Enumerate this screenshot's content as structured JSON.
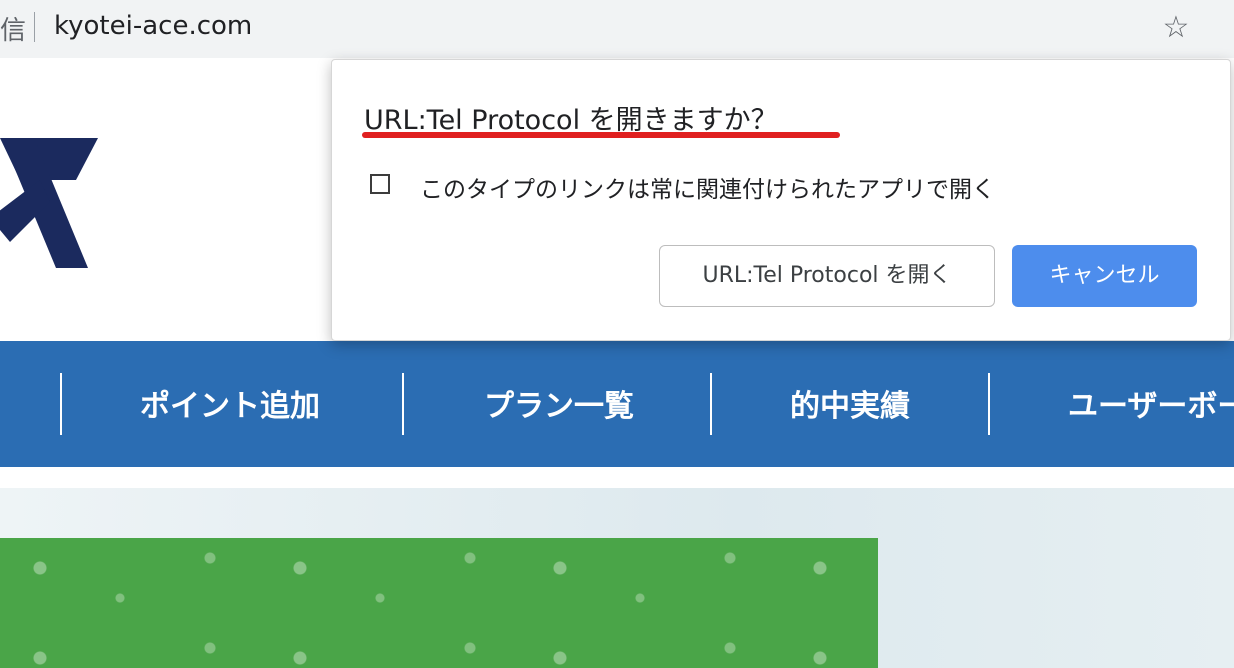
{
  "browser": {
    "security_label": "信",
    "url": "kyotei-ace.com"
  },
  "nav": {
    "items": [
      {
        "label": "ポイント追加"
      },
      {
        "label": "プラン一覧"
      },
      {
        "label": "的中実績"
      },
      {
        "label": "ユーザーボー"
      }
    ]
  },
  "dialog": {
    "title": "URL:Tel Protocol を開きますか？",
    "checkbox_label": "このタイプのリンクは常に関連付けられたアプリで開く",
    "checkbox_checked": false,
    "open_button": "URL:Tel Protocol を開く",
    "cancel_button": "キャンセル"
  },
  "colors": {
    "nav_bar": "#2b6db3",
    "cancel_button": "#4d8ded",
    "title_underline": "#e02020",
    "logo": "#1b2a5e",
    "hero_green": "#4aa548"
  },
  "icons": {
    "bookmark": "star-icon"
  }
}
